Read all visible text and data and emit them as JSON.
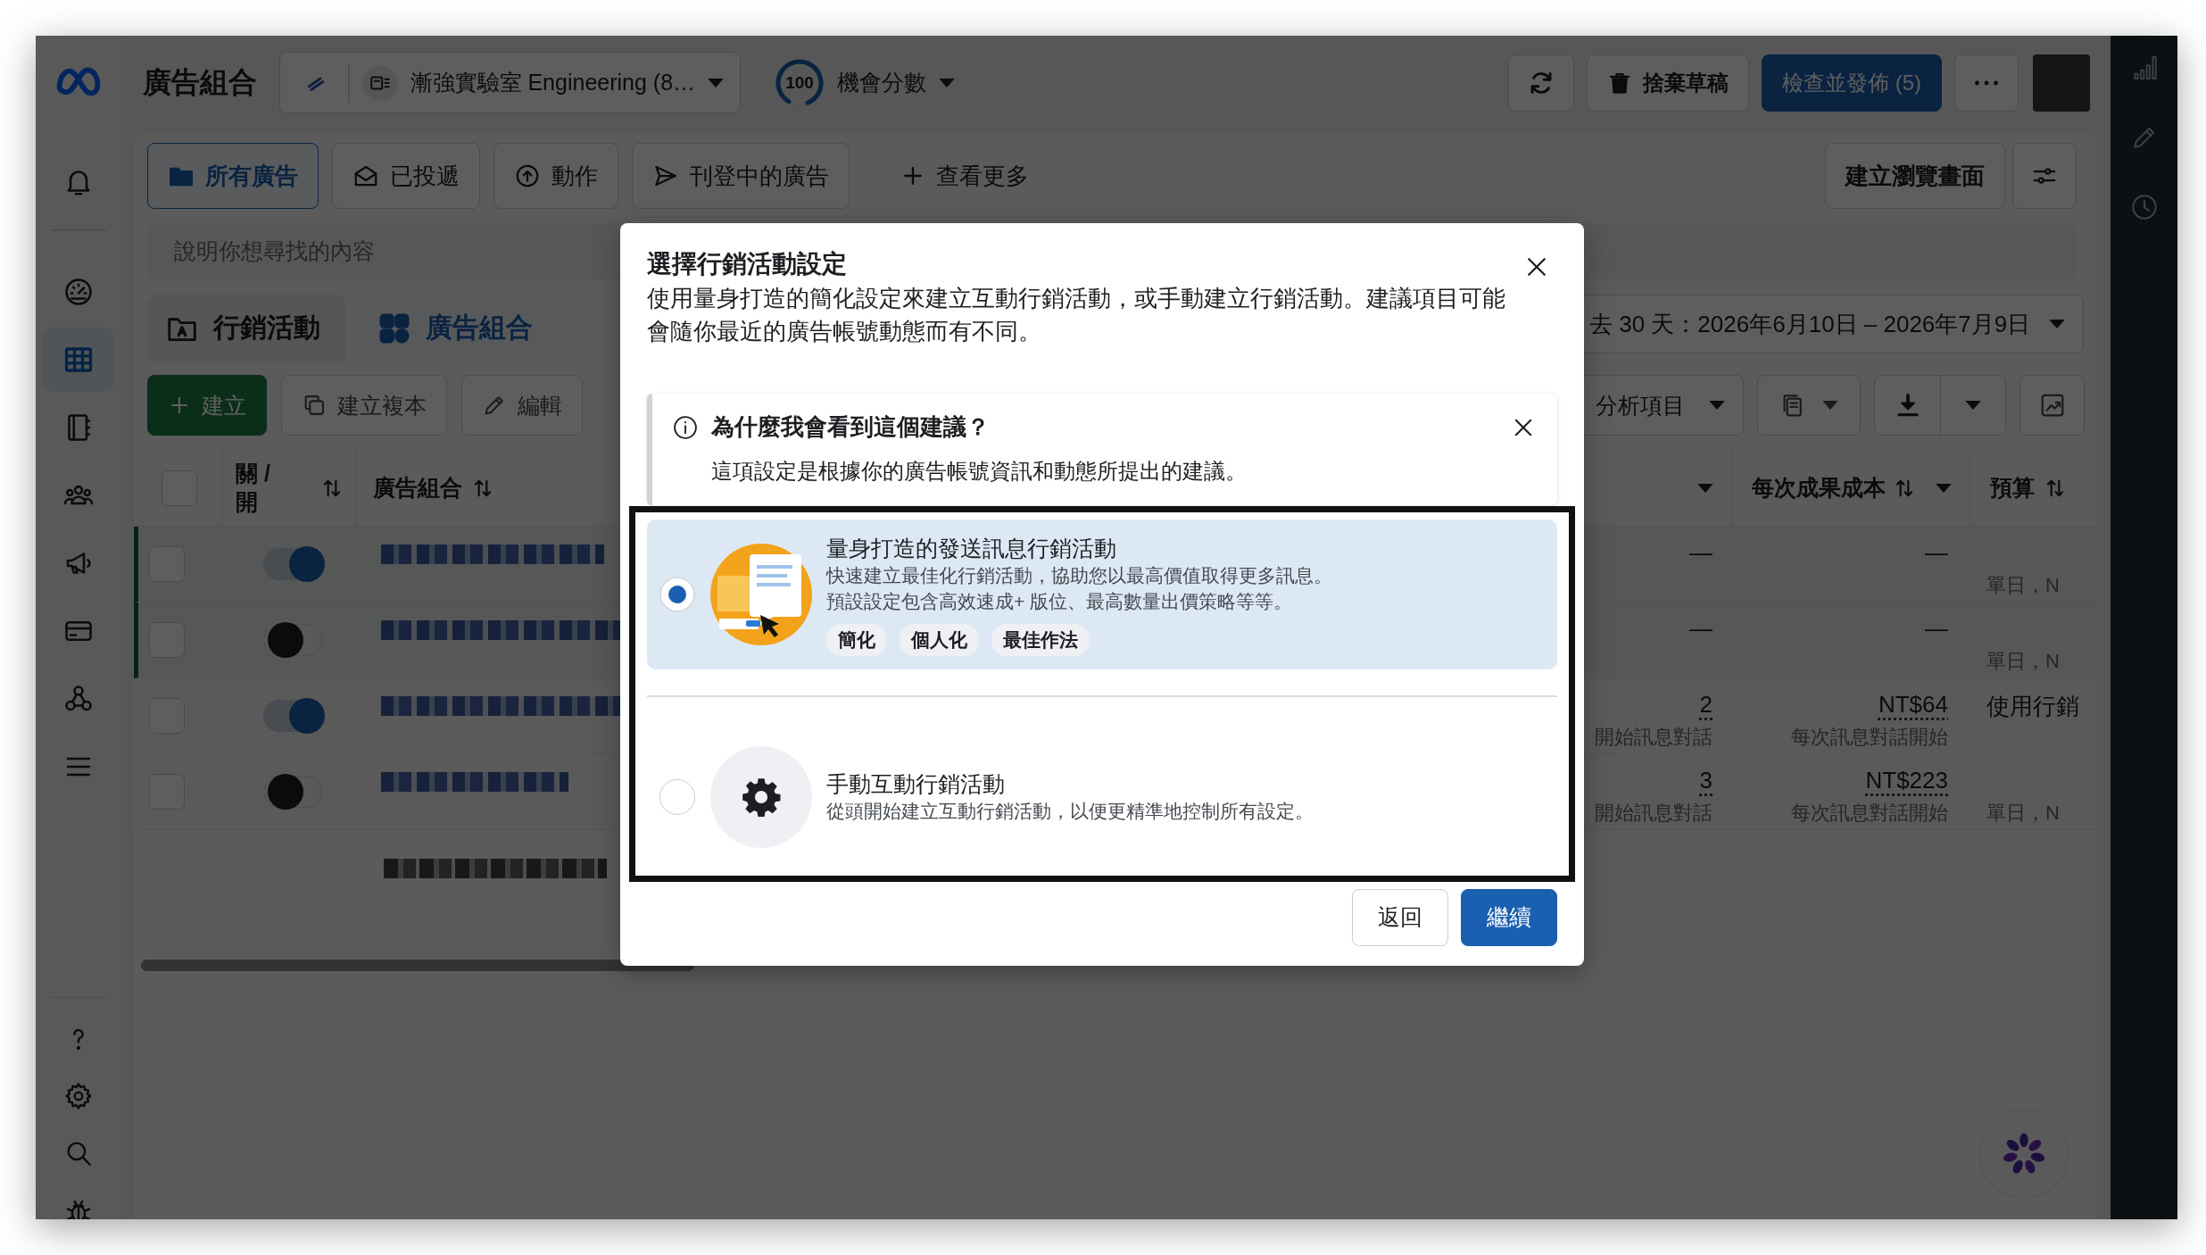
{
  "nav_rail": {
    "items": [
      {
        "selected": false
      },
      {
        "selected": false
      },
      {
        "selected": true
      },
      {
        "selected": false
      },
      {
        "selected": false
      },
      {
        "selected": false
      },
      {
        "selected": false
      },
      {
        "selected": false
      },
      {
        "selected": false
      }
    ]
  },
  "header": {
    "title": "廣告組合",
    "account": "漸強實驗室 Engineering (8…",
    "score": "100",
    "score_label": "機會分數",
    "discard_button": "捨棄草稿",
    "publish_button": "檢查並發佈 (5)"
  },
  "filters": {
    "tabs": [
      {
        "label": "所有廣告",
        "selected": true
      },
      {
        "label": "已投遞",
        "selected": false
      },
      {
        "label": "動作",
        "selected": false
      },
      {
        "label": "刊登中的廣告",
        "selected": false
      }
    ],
    "see_more": "查看更多",
    "create_view_button": "建立瀏覽畫面"
  },
  "search": {
    "placeholder": "說明你想尋找的內容"
  },
  "level_tabs": [
    {
      "label": "行銷活動",
      "selected": false
    },
    {
      "label": "廣告組合",
      "selected": true
    }
  ],
  "date_range": "去 30 天：2026年6月10日 – 2026年7月9日",
  "toolbar": {
    "create_button": "建立",
    "duplicate_button": "建立複本",
    "edit_button": "編輯",
    "breakdown_button": "分析項目"
  },
  "table": {
    "header_checked": false,
    "columns": [
      "關 / 開",
      "廣告組合",
      "每次成果成本",
      "預算"
    ],
    "rows": [
      {
        "selected": true,
        "checked": false,
        "on": true,
        "results": "—",
        "cost": "—",
        "budget_note": "單日，N"
      },
      {
        "selected": true,
        "checked": false,
        "on": false,
        "results": "—",
        "cost": "—",
        "budget_note": "單日，N"
      },
      {
        "selected": false,
        "checked": false,
        "on": true,
        "results": "2",
        "results_label": "開始訊息對話",
        "cost": "NT$64",
        "cost_label": "每次訊息對話開始",
        "budget": "使用行銷"
      },
      {
        "selected": false,
        "checked": false,
        "on": false,
        "results": "3",
        "results_label": "開始訊息對話",
        "cost": "NT$223",
        "cost_label": "每次訊息對話開始",
        "budget_note": "單日，N"
      }
    ]
  },
  "dialog": {
    "title": "選擇行銷活動設定",
    "description": "使用量身打造的簡化設定來建立互動行銷活動，或手動建立行銷活動。建議項目可能會隨你最近的廣告帳號動態而有不同。",
    "notice": {
      "title": "為什麼我會看到這個建議？",
      "body": "這項設定是根據你的廣告帳號資訊和動態所提出的建議。"
    },
    "options": [
      {
        "kind": "illustration",
        "selected": true,
        "title": "量身打造的發送訊息行銷活動",
        "lines": [
          "快速建立最佳化行銷活動，協助您以最高價值取得更多訊息。",
          "預設設定包含高效速成+ 版位、最高數量出價策略等等。"
        ],
        "tags": [
          "簡化",
          "個人化",
          "最佳作法"
        ]
      },
      {
        "kind": "gear",
        "selected": false,
        "title": "手動互動行銷活動",
        "lines": [
          "從頭開始建立互動行銷活動，以便更精準地控制所有設定。"
        ]
      }
    ],
    "back_button": "返回",
    "continue_button": "繼續"
  }
}
